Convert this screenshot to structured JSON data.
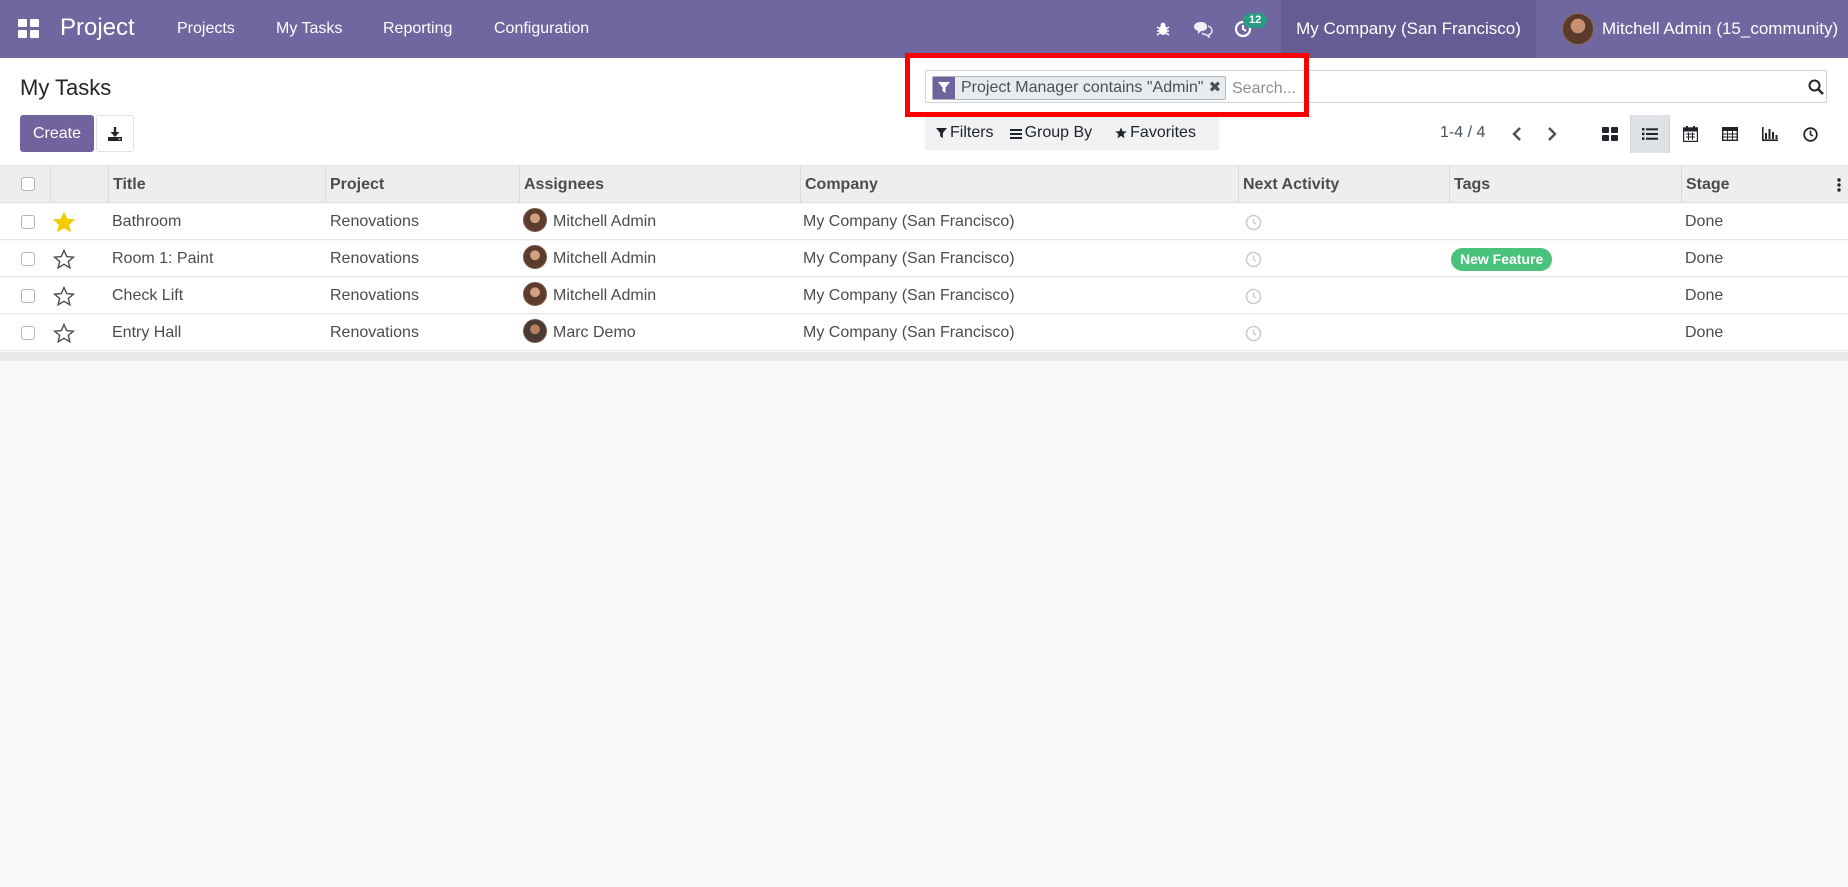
{
  "navbar": {
    "brand": "Project",
    "menu": [
      "Projects",
      "My Tasks",
      "Reporting",
      "Configuration"
    ],
    "activity_count": "12",
    "company": "My Company (San Francisco)",
    "user": "Mitchell Admin (15_community)",
    "color": "#7066a0"
  },
  "control_panel": {
    "title": "My Tasks",
    "create_label": "Create",
    "search": {
      "facet": "Project Manager contains \"Admin\"",
      "facet_close": "✖",
      "placeholder": "Search..."
    },
    "filters_label": "Filters",
    "group_by_label": "Group By",
    "favorites_label": "Favorites",
    "pager": "1-4 / 4",
    "views": [
      "kanban-icon",
      "list-icon",
      "calendar-icon",
      "pivot-icon",
      "graph-icon",
      "activity-icon"
    ],
    "active_view": "list-icon"
  },
  "table": {
    "columns": [
      "Title",
      "Project",
      "Assignees",
      "Company",
      "Next Activity",
      "Tags",
      "Stage"
    ],
    "rows": [
      {
        "starred": true,
        "title": "Bathroom",
        "project": "Renovations",
        "assignee": "Mitchell Admin",
        "company": "My Company (San Francisco)",
        "tag": "",
        "stage": "Done"
      },
      {
        "starred": false,
        "title": "Room 1: Paint",
        "project": "Renovations",
        "assignee": "Mitchell Admin",
        "company": "My Company (San Francisco)",
        "tag": "New Feature",
        "stage": "Done"
      },
      {
        "starred": false,
        "title": "Check Lift",
        "project": "Renovations",
        "assignee": "Mitchell Admin",
        "company": "My Company (San Francisco)",
        "tag": "",
        "stage": "Done"
      },
      {
        "starred": false,
        "title": "Entry Hall",
        "project": "Renovations",
        "assignee": "Marc Demo",
        "company": "My Company (San Francisco)",
        "tag": "",
        "stage": "Done"
      }
    ],
    "tag_color": "#49c27b",
    "star_color": "#f3cc00"
  }
}
